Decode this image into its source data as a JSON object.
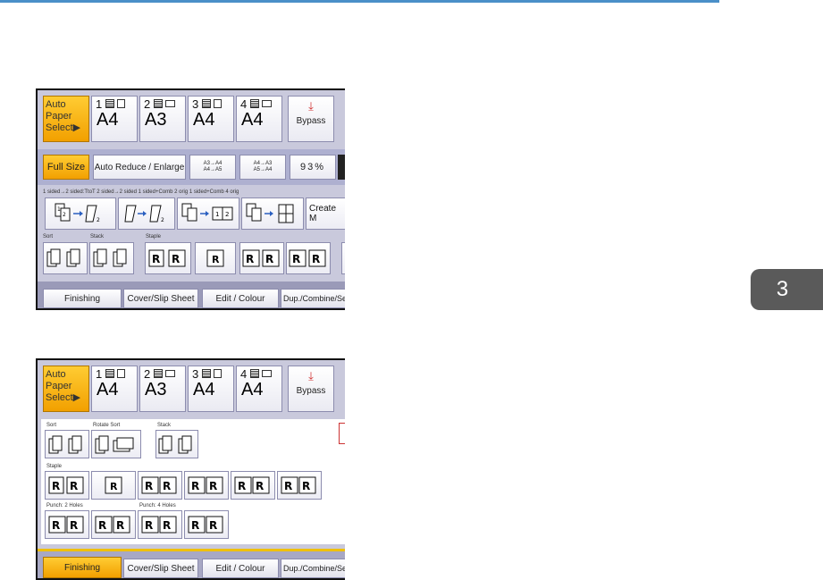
{
  "tray_row": {
    "auto_paper_select": "Auto Paper Select▶",
    "trays": [
      {
        "num": "1",
        "size": "A4"
      },
      {
        "num": "2",
        "size": "A3"
      },
      {
        "num": "3",
        "size": "A4"
      },
      {
        "num": "4",
        "size": "A4"
      }
    ],
    "bypass_icon": "⤓",
    "bypass_label": "Bypass"
  },
  "screen1": {
    "full_size": "Full Size",
    "auto_reduce": "Auto Reduce / Enlarge",
    "preset1_line1": "A3→A4",
    "preset1_line2": "A4→A5",
    "preset2_line1": "A4→A3",
    "preset2_line2": "A5→A4",
    "zoom": "93%",
    "duplex_labels": "1 sided→2 sided:TtoT    2 sided→2 sided    1 sided+Comb 2 orig 1 sided+Comb 4 orig",
    "create_margin": "Create M",
    "sort_label": "Sort",
    "stack_label": "Stack",
    "staple_label": "Staple"
  },
  "screen2": {
    "sort_label": "Sort",
    "rotate_sort_label": "Rotate Sort",
    "stack_label": "Stack",
    "staple_label": "Staple",
    "punch2_label": "Punch: 2 Holes",
    "punch4_label": "Punch: 4 Holes"
  },
  "tabs": {
    "finishing": "Finishing",
    "cover_slip": "Cover/Slip Sheet",
    "edit_colour": "Edit / Colour",
    "dup_combine": "Dup./Combine/Series"
  },
  "chapter": "3",
  "colors": {
    "accent": "#f2a000",
    "header_rule": "#4a8fc8",
    "chapter_tab": "#5a5a5a"
  }
}
